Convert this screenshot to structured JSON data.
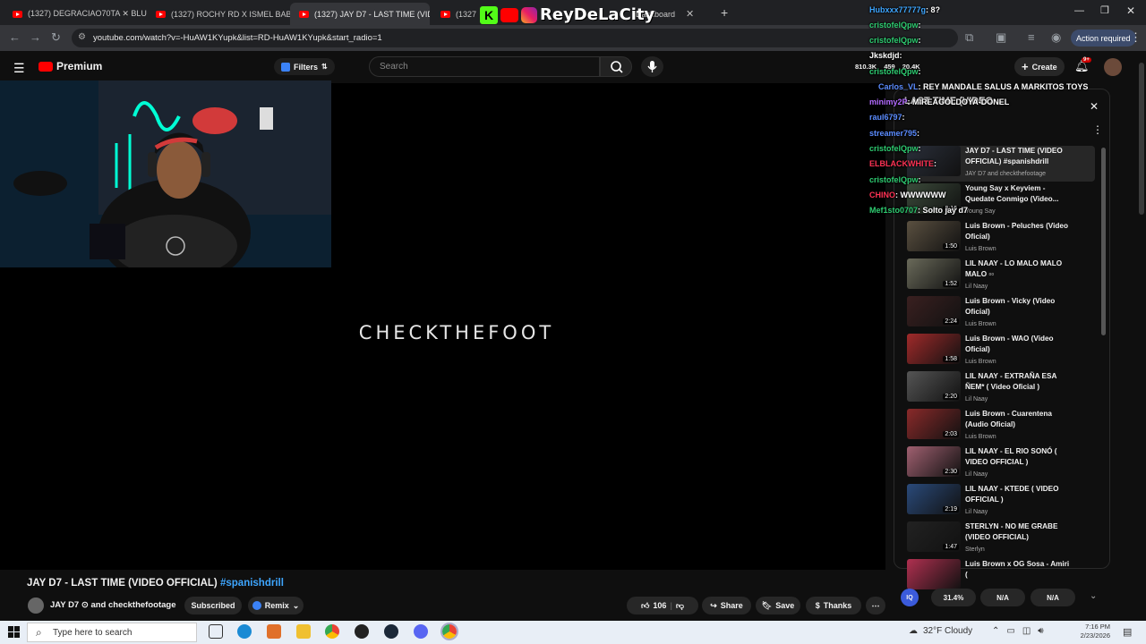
{
  "browser": {
    "tabs": [
      {
        "title": "(1327) DEGRACIAO70TA ✕ BLU",
        "active": false
      },
      {
        "title": "(1327) ROCHY RD X ISMEL BAB",
        "active": false
      },
      {
        "title": "(1327) JAY D7 - LAST TIME (VID",
        "active": true
      },
      {
        "title": "(1327) I",
        "active": false
      },
      {
        "title": "Dashboard",
        "active": false
      }
    ],
    "url": "youtube.com/watch?v=-HuAW1KYupk&list=RD-HuAW1KYupk&start_radio=1",
    "action_required": "Action required"
  },
  "overlay_brand": "ReyDeLaCity",
  "youtube": {
    "logo_text": "Premium",
    "filters_label": "Filters",
    "search_placeholder": "Search",
    "stream_stats": [
      "810.3K",
      "459",
      "20.4K"
    ],
    "create_label": "Create",
    "notif_count": "9+"
  },
  "video": {
    "watermark": "CHECKTHEFOOT",
    "title": "JAY D7 - LAST TIME (VIDEO OFFICIAL)",
    "hashtag": "#spanishdrill",
    "channel": "JAY D7 ⊙ and checkthefootage",
    "subscribed_label": "Subscribed",
    "remix_label": "Remix",
    "likes": "106",
    "share_label": "Share",
    "save_label": "Save",
    "thanks_label": "Thanks"
  },
  "playlist": {
    "header": "LAST TIME (VIDEO...",
    "items": [
      {
        "title": "JAY D7 - LAST TIME (VIDEO OFFICIAL) #spanishdrill",
        "channel": "JAY D7 and checkthefootage",
        "duration": "",
        "color": "#2a2f3a"
      },
      {
        "title": "Young Say x Keyviem - Quedate Conmigo (Video...",
        "channel": "Young Say",
        "duration": "3:16",
        "color": "#3b4a3a"
      },
      {
        "title": "Luis Brown - Peluches (Video Oficial)",
        "channel": "Luis Brown",
        "duration": "1:50",
        "color": "#5a5040"
      },
      {
        "title": "LIL NAAY - LO MALO MALO MALO ▫▫",
        "channel": "Lil Naay",
        "duration": "1:52",
        "color": "#6a6a5a"
      },
      {
        "title": "Luis Brown - Vicky (Video Oficial)",
        "channel": "Luis Brown",
        "duration": "2:24",
        "color": "#3a2020"
      },
      {
        "title": "Luis Brown - WAO (Video Oficial)",
        "channel": "Luis Brown",
        "duration": "1:58",
        "color": "#a02a2a"
      },
      {
        "title": "LIL NAAY - EXTRAÑA ESA ÑEM* ( Video Oficial )",
        "channel": "Lil Naay",
        "duration": "2:20",
        "color": "#555"
      },
      {
        "title": "Luis Brown - Cuarentena (Audio Oficial)",
        "channel": "Luis Brown",
        "duration": "2:03",
        "color": "#8a2a2a"
      },
      {
        "title": "LIL NAAY - EL RIO SONÓ ( VIDEO OFFICIAL )",
        "channel": "Lil Naay",
        "duration": "2:30",
        "color": "#a06070"
      },
      {
        "title": "LIL NAAY - KTEDE ( VIDEO OFFICIAL )",
        "channel": "Lil Naay",
        "duration": "2:19",
        "color": "#2a4a7a"
      },
      {
        "title": "STERLYN - NO ME GRABE (VIDEO OFFICIAL)",
        "channel": "Sterlyn",
        "duration": "1:47",
        "color": "#222"
      },
      {
        "title": "Luis Brown x OG Sosa - Amiri (",
        "channel": "",
        "duration": "",
        "color": "#b03050"
      }
    ]
  },
  "chat": [
    {
      "user": "Hubxxx77777g",
      "msg": ": 8?",
      "color": "#3ea6ff"
    },
    {
      "user": "cristofelQpw",
      "msg": ":",
      "color": "#2ecc71"
    },
    {
      "user": "cristofelQpw",
      "msg": ":",
      "color": "#2ecc71"
    },
    {
      "user": "Jkskdjd",
      "msg": ":",
      "color": "#ffffff"
    },
    {
      "user": "cristofelQpw",
      "msg": ":",
      "color": "#2ecc71"
    },
    {
      "user": "Carlos_VL",
      "msg": ": REY MANDALE SALUS A MARKITOS TOYS",
      "color": "#5b8cff"
    },
    {
      "user": "minimy2P",
      "msg": ": MIREAGOLDOYA-DONEL",
      "color": "#b36bff"
    },
    {
      "user": "raul6797",
      "msg": ":",
      "color": "#5b8cff"
    },
    {
      "user": "streamer795",
      "msg": ":",
      "color": "#5b8cff"
    },
    {
      "user": "cristofelQpw",
      "msg": ":",
      "color": "#2ecc71"
    },
    {
      "user": "ELBLACKWHITE",
      "msg": ":",
      "color": "#ff3355"
    },
    {
      "user": "cristofelQpw",
      "msg": ":",
      "color": "#2ecc71"
    },
    {
      "user": "CHINO",
      "msg": ": WWWWWW",
      "color": "#ff3355"
    },
    {
      "user": "Mef1sto0707",
      "msg": ": Solto jay d7",
      "color": "#2ecc71"
    }
  ],
  "stats_bar": {
    "percent": "31.4%",
    "na1": "N/A",
    "na2": "N/A"
  },
  "taskbar": {
    "search_placeholder": "Type here to search",
    "weather": "32°F  Cloudy",
    "time": "7:16 PM",
    "date": "2/23/2026"
  }
}
